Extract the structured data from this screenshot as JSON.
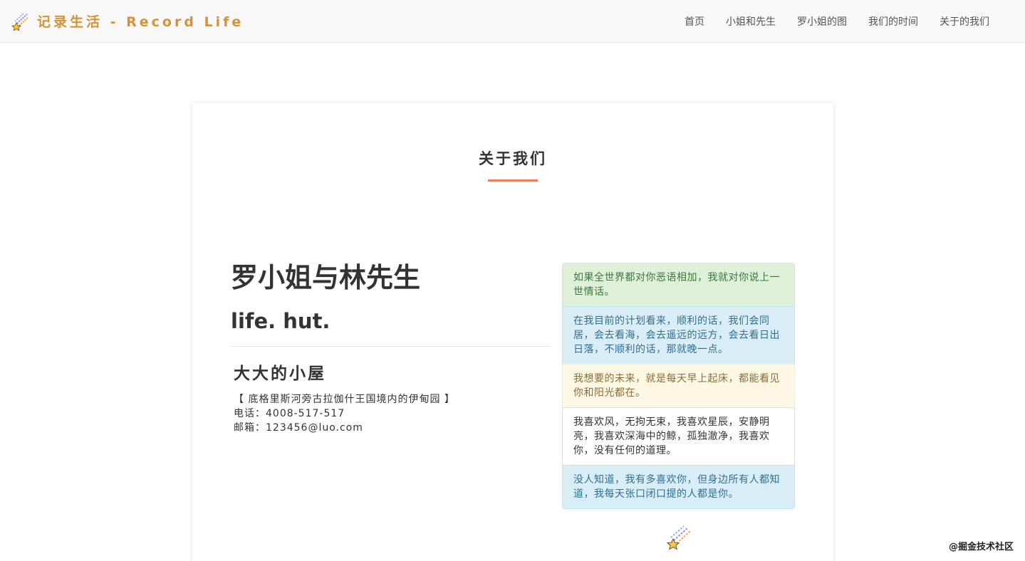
{
  "navbar": {
    "brand": "记录生活 - Record Life",
    "links": [
      "首页",
      "小姐和先生",
      "罗小姐的图",
      "我们的时间",
      "关于的我们"
    ]
  },
  "section": {
    "title": "关于我们"
  },
  "profile": {
    "heading": "罗小姐与林先生",
    "subheading": "life. hut.",
    "house": "大大的小屋",
    "address": "【 底格里斯河旁古拉伽什王国境内的伊甸园 】",
    "phone": "电话：4008-517-517",
    "email": "邮箱：123456@luo.com"
  },
  "quotes": [
    "如果全世界都对你恶语相加，我就对你说上一世情话。",
    "在我目前的计划看来，顺利的话，我们会同居，会去看海，会去遥远的远方，会去看日出日落，不顺利的话，那就晚一点。",
    "我想要的未来，就是每天早上起床，都能看见你和阳光都在。",
    "我喜欢风，无拘无束，我喜欢星辰，安静明亮，我喜欢深海中的鲸，孤独澈净，我喜欢你，没有任何的道理。",
    "没人知道，我有多喜欢你，但身边所有人都知道，我每天张口闭口提的人都是你。"
  ],
  "watermark": "@掘金技术社区",
  "icons": {
    "brand": "shooting-star-icon",
    "bottom": "shooting-star-icon"
  },
  "colors": {
    "brand": "#d2933b",
    "underline": "#e8825e"
  }
}
